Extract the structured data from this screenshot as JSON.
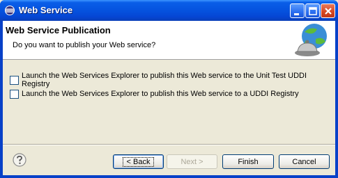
{
  "window": {
    "title": "Web Service"
  },
  "header": {
    "title": "Web Service Publication",
    "description": "Do you want to publish your Web service?"
  },
  "options": [
    {
      "label": "Launch the Web Services Explorer to publish this Web service to the Unit Test UDDI Registry",
      "checked": false
    },
    {
      "label": "Launch the Web Services Explorer to publish this Web service to a UDDI Registry",
      "checked": false
    }
  ],
  "buttons": {
    "back": "< Back",
    "next": "Next >",
    "finish": "Finish",
    "cancel": "Cancel"
  },
  "colors": {
    "titlebar": "#0553df",
    "close_button": "#d64620",
    "disabled_text": "#aca899"
  },
  "icons": [
    "eclipse-icon",
    "minimize-icon",
    "maximize-icon",
    "close-icon",
    "globe-bell-icon",
    "help-icon"
  ]
}
